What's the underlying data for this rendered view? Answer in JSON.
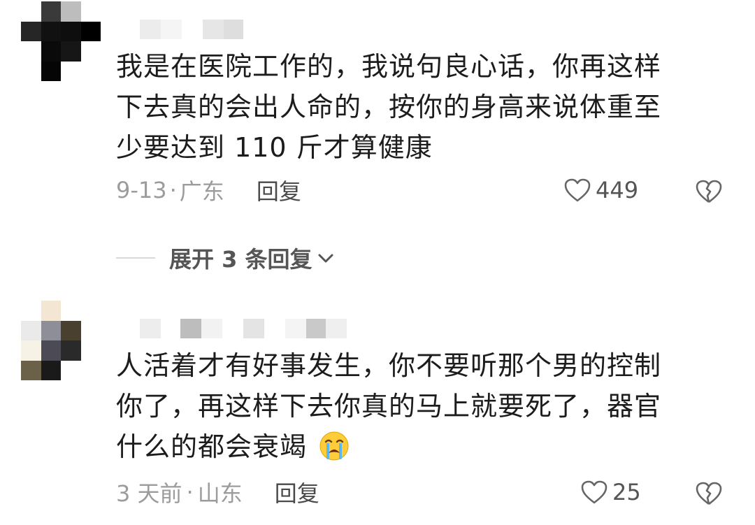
{
  "comments": [
    {
      "text_lines": [
        "我是在医院工作的，我说句良心话，你再这样",
        "下去真的会出人命的，按你的身高来说体重至",
        "少要达到 110 斤才算健康"
      ],
      "date": "9-13",
      "separator": "·",
      "location": "广东",
      "reply_label": "回复",
      "likes": "449",
      "expand_label": "展开 3 条回复"
    },
    {
      "text_lines": [
        "人活着才有好事发生，你不要听那个男的控制",
        "你了，再这样下去你真的马上就要死了，器官",
        "什么的都会衰竭"
      ],
      "emoji": "crying-face-emoji",
      "date": "3 天前",
      "separator": "·",
      "location": "山东",
      "reply_label": "回复",
      "likes": "25"
    }
  ],
  "icons": {
    "like": "heart-outline-icon",
    "dislike": "broken-heart-icon",
    "expand": "chevron-down-icon"
  },
  "colors": {
    "text": "#1c1c1c",
    "meta": "#9c9c9c",
    "reply": "#4a4a4a",
    "icon": "#555555"
  }
}
